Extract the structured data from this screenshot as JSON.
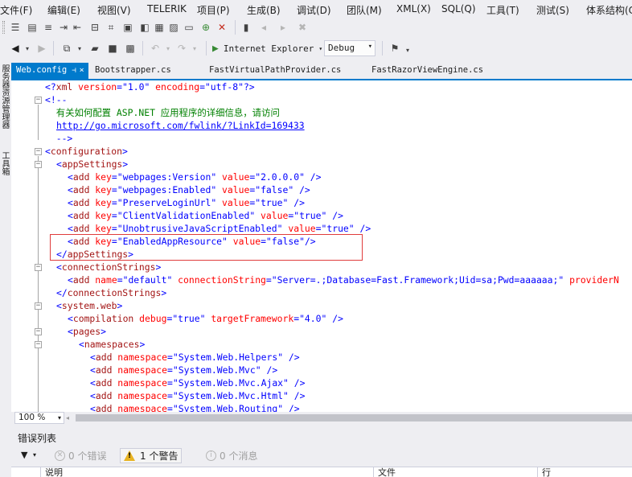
{
  "menu": [
    "文件(F)",
    "编辑(E)",
    "视图(V)",
    "TELERIK",
    "项目(P)",
    "生成(B)",
    "调试(D)",
    "团队(M)",
    "XML(X)",
    "SQL(Q)",
    "工具(T)",
    "测试(S)",
    "体系结构(C)"
  ],
  "toolbar": {
    "run_label": "Internet Explorer",
    "config_value": "Debug"
  },
  "side_tabs": [
    "服务器资源管理器",
    "工具箱"
  ],
  "tabs": [
    {
      "label": "Web.config",
      "pin": "⊣",
      "close": "×"
    },
    {
      "label": "Bootstrapper.cs"
    },
    {
      "label": "FastVirtualPathProvider.cs"
    },
    {
      "label": "FastRazorViewEngine.cs"
    }
  ],
  "code": {
    "l1": {
      "a": "<?",
      "b": "xml",
      "c": " version",
      "d": "=",
      "e": "\"1.0\"",
      "f": " encoding",
      "g": "=",
      "h": "\"utf-8\"",
      "i": "?>"
    },
    "l2": "<!--",
    "l3": "  有关如何配置 ASP.NET 应用程序的详细信息，请访问",
    "l4": "http://go.microsoft.com/fwlink/?LinkId=169433",
    "l5": "  -->",
    "l6_tag": "configuration",
    "l7_tag": "appSettings",
    "settings": [
      {
        "key": "webpages:Version",
        "value": "2.0.0.0"
      },
      {
        "key": "webpages:Enabled",
        "value": "false"
      },
      {
        "key": "PreserveLoginUrl",
        "value": "true"
      },
      {
        "key": "ClientValidationEnabled",
        "value": "true"
      },
      {
        "key": "UnobtrusiveJavaScriptEnabled",
        "value": "true"
      },
      {
        "key": "EnabledAppResource",
        "value": "false"
      }
    ],
    "close_appsettings": "appSettings",
    "connstr_tag": "connectionStrings",
    "conn": {
      "name": "default",
      "cs": "Server=.;Database=Fast.Framework;Uid=sa;Pwd=aaaaaa;",
      "provider_attr": "providerN"
    },
    "sysweb_tag": "system.web",
    "compilation": {
      "debug": "true",
      "framework": "4.0"
    },
    "pages_tag": "pages",
    "ns_tag": "namespaces",
    "namespaces": [
      "System.Web.Helpers",
      "System.Web.Mvc",
      "System.Web.Mvc.Ajax",
      "System.Web.Mvc.Html",
      "System.Web.Routing"
    ]
  },
  "zoom": "100 %",
  "errorlist": {
    "title": "错误列表",
    "errors": "0 个错误",
    "warnings": "1 个警告",
    "messages": "0 个消息",
    "col_desc": "说明",
    "col_file": "文件",
    "col_line": "行"
  },
  "colors": {
    "accent": "#007acc",
    "highlight": "#e03c3c",
    "warning": "#e8b321"
  }
}
